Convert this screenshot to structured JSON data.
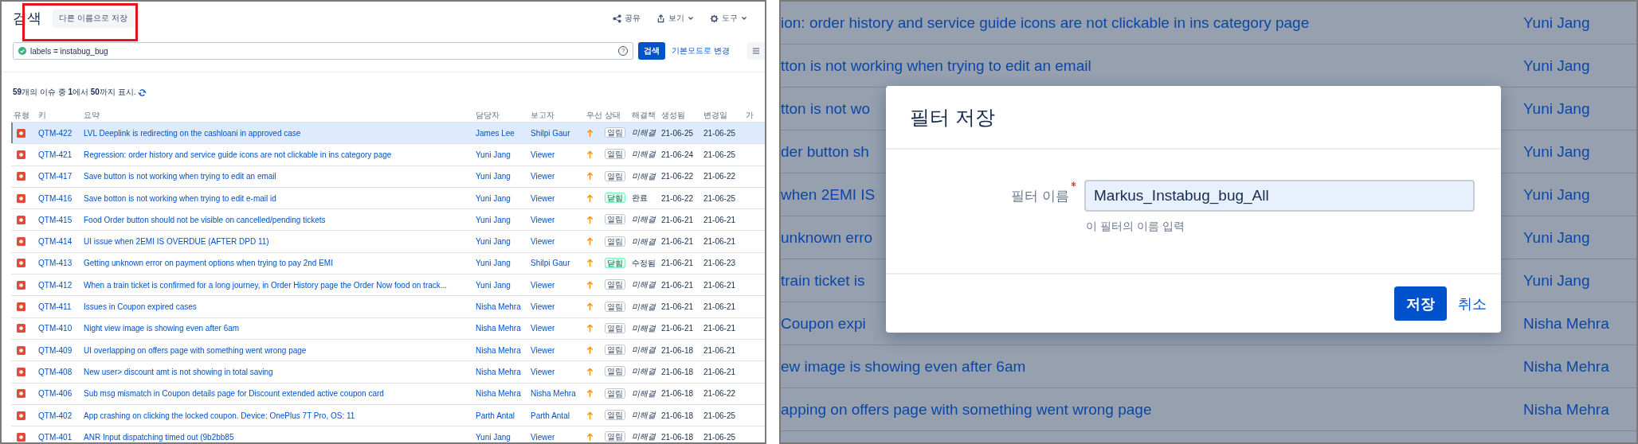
{
  "left": {
    "title": "검색",
    "save_as_button": {
      "label": "다른 이름으로 저장",
      "highlighted": true
    },
    "actions": [
      {
        "label": "공유",
        "kind": "share",
        "dropdown": false
      },
      {
        "label": "보기",
        "kind": "export",
        "dropdown": true
      },
      {
        "label": "도구",
        "kind": "gear",
        "dropdown": true
      }
    ],
    "query": {
      "value": "labels = instabug_bug",
      "valid": true,
      "help_mark": "?"
    },
    "search_button": "검색",
    "switch_link": "기본모드로 변경",
    "summary_text": "**59**개의 이슈 중 **1**에서 **50**까지 표시.",
    "columns": [
      "유형",
      "키",
      "요약",
      "담당자",
      "보고자",
      "우선",
      "상태",
      "해결책",
      "생성됨",
      "변경일",
      "가"
    ],
    "rows": [
      {
        "key": "QTM-422",
        "summary": "LVL Deeplink is redirecting on the cashloani in approved case",
        "assignee": "James Lee",
        "reporter": "Shilpi Gaur",
        "status": {
          "label": "열림",
          "kind": "open"
        },
        "resolution": "미해결",
        "resolved": false,
        "created": "21-06-25",
        "updated": "21-06-25",
        "selected": true
      },
      {
        "key": "QTM-421",
        "summary": "Regression: order history and service guide icons are not clickable in ins category page",
        "assignee": "Yuni Jang",
        "reporter": "Viewer",
        "status": {
          "label": "열림",
          "kind": "open"
        },
        "resolution": "미해결",
        "resolved": false,
        "created": "21-06-24",
        "updated": "21-06-25",
        "selected": false
      },
      {
        "key": "QTM-417",
        "summary": "Save button is not working when trying to edit an email",
        "assignee": "Yuni Jang",
        "reporter": "Viewer",
        "status": {
          "label": "열림",
          "kind": "open"
        },
        "resolution": "미해결",
        "resolved": false,
        "created": "21-06-22",
        "updated": "21-06-22",
        "selected": false
      },
      {
        "key": "QTM-416",
        "summary": "Save botton is not working when trying to edit e-mail id",
        "assignee": "Yuni Jang",
        "reporter": "Viewer",
        "status": {
          "label": "닫힘",
          "kind": "closed"
        },
        "resolution": "완료",
        "resolved": true,
        "created": "21-06-22",
        "updated": "21-06-25",
        "selected": false
      },
      {
        "key": "QTM-415",
        "summary": "Food Order button should not be visible on cancelled/pending tickets",
        "assignee": "Yuni Jang",
        "reporter": "Viewer",
        "status": {
          "label": "열림",
          "kind": "open"
        },
        "resolution": "미해결",
        "resolved": false,
        "created": "21-06-21",
        "updated": "21-06-21",
        "selected": false
      },
      {
        "key": "QTM-414",
        "summary": "UI issue when 2EMI IS OVERDUE (AFTER DPD 11)",
        "assignee": "Yuni Jang",
        "reporter": "Viewer",
        "status": {
          "label": "열림",
          "kind": "open"
        },
        "resolution": "미해결",
        "resolved": false,
        "created": "21-06-21",
        "updated": "21-06-21",
        "selected": false
      },
      {
        "key": "QTM-413",
        "summary": "Getting unknown error on payment options when trying to pay 2nd EMI",
        "assignee": "Yuni Jang",
        "reporter": "Shilpi Gaur",
        "status": {
          "label": "닫힘",
          "kind": "closed"
        },
        "resolution": "수정됨",
        "resolved": true,
        "created": "21-06-21",
        "updated": "21-06-23",
        "selected": false
      },
      {
        "key": "QTM-412",
        "summary": "When a train ticket is confirmed for a long journey, in Order History page the Order Now food on track...",
        "assignee": "Yuni Jang",
        "reporter": "Viewer",
        "status": {
          "label": "열림",
          "kind": "open"
        },
        "resolution": "미해결",
        "resolved": false,
        "created": "21-06-21",
        "updated": "21-06-21",
        "selected": false
      },
      {
        "key": "QTM-411",
        "summary": "Issues in Coupon expired cases",
        "assignee": "Nisha Mehra",
        "reporter": "Viewer",
        "status": {
          "label": "열림",
          "kind": "open"
        },
        "resolution": "미해결",
        "resolved": false,
        "created": "21-06-21",
        "updated": "21-06-21",
        "selected": false
      },
      {
        "key": "QTM-410",
        "summary": "Night view image is showing even after 6am",
        "assignee": "Nisha Mehra",
        "reporter": "Viewer",
        "status": {
          "label": "열림",
          "kind": "open"
        },
        "resolution": "미해결",
        "resolved": false,
        "created": "21-06-21",
        "updated": "21-06-21",
        "selected": false
      },
      {
        "key": "QTM-409",
        "summary": "UI overlapping on offers page with something went wrong page",
        "assignee": "Nisha Mehra",
        "reporter": "Viewer",
        "status": {
          "label": "열림",
          "kind": "open"
        },
        "resolution": "미해결",
        "resolved": false,
        "created": "21-06-18",
        "updated": "21-06-21",
        "selected": false
      },
      {
        "key": "QTM-408",
        "summary": "New user> discount amt is not showing in total saving",
        "assignee": "Nisha Mehra",
        "reporter": "Viewer",
        "status": {
          "label": "열림",
          "kind": "open"
        },
        "resolution": "미해결",
        "resolved": false,
        "created": "21-06-18",
        "updated": "21-06-21",
        "selected": false
      },
      {
        "key": "QTM-406",
        "summary": "Sub msg mismatch in Coupon details page for Discount extended active coupon card",
        "assignee": "Nisha Mehra",
        "reporter": "Nisha Mehra",
        "status": {
          "label": "열림",
          "kind": "open"
        },
        "resolution": "미해결",
        "resolved": false,
        "created": "21-06-18",
        "updated": "21-06-22",
        "selected": false
      },
      {
        "key": "QTM-402",
        "summary": "App crashing on clicking the locked coupon. Device: OnePlus 7T Pro, OS: 11",
        "assignee": "Parth Antal",
        "reporter": "Parth Antal",
        "status": {
          "label": "열림",
          "kind": "open"
        },
        "resolution": "미해결",
        "resolved": false,
        "created": "21-06-18",
        "updated": "21-06-25",
        "selected": false
      },
      {
        "key": "QTM-401",
        "summary": "ANR Input dispatching timed out (9b2bb85",
        "assignee": "Yuni Jang",
        "reporter": "Viewer",
        "status": {
          "label": "열림",
          "kind": "open"
        },
        "resolution": "미해결",
        "resolved": false,
        "created": "21-06-18",
        "updated": "21-06-25",
        "selected": false
      }
    ]
  },
  "right": {
    "rows": [
      {
        "summary": "ion: order history and service guide icons are not clickable in ins category page",
        "assignee": "Yuni Jang"
      },
      {
        "summary": "tton is not working when trying to edit an email",
        "assignee": "Yuni Jang"
      },
      {
        "summary": "tton is not wo",
        "assignee": "Yuni Jang"
      },
      {
        "summary": "der button sh",
        "assignee": "Yuni Jang"
      },
      {
        "summary": "when 2EMI IS",
        "assignee": "Yuni Jang"
      },
      {
        "summary": "unknown erro",
        "assignee": "Yuni Jang"
      },
      {
        "summary": "train ticket is",
        "assignee": "Yuni Jang"
      },
      {
        "summary": "Coupon expi",
        "assignee": "Nisha Mehra"
      },
      {
        "summary": "ew image is showing even after 6am",
        "assignee": "Nisha Mehra"
      },
      {
        "summary": "apping on offers page with something went wrong page",
        "assignee": "Nisha Mehra"
      }
    ],
    "dialog": {
      "title": "필터 저장",
      "field_label": "필터 이름",
      "required": true,
      "value": "Markus_Instabug_bug_All",
      "hint": "이 필터의 이름 입력",
      "save_button": "저장",
      "cancel_link": "취소"
    }
  }
}
